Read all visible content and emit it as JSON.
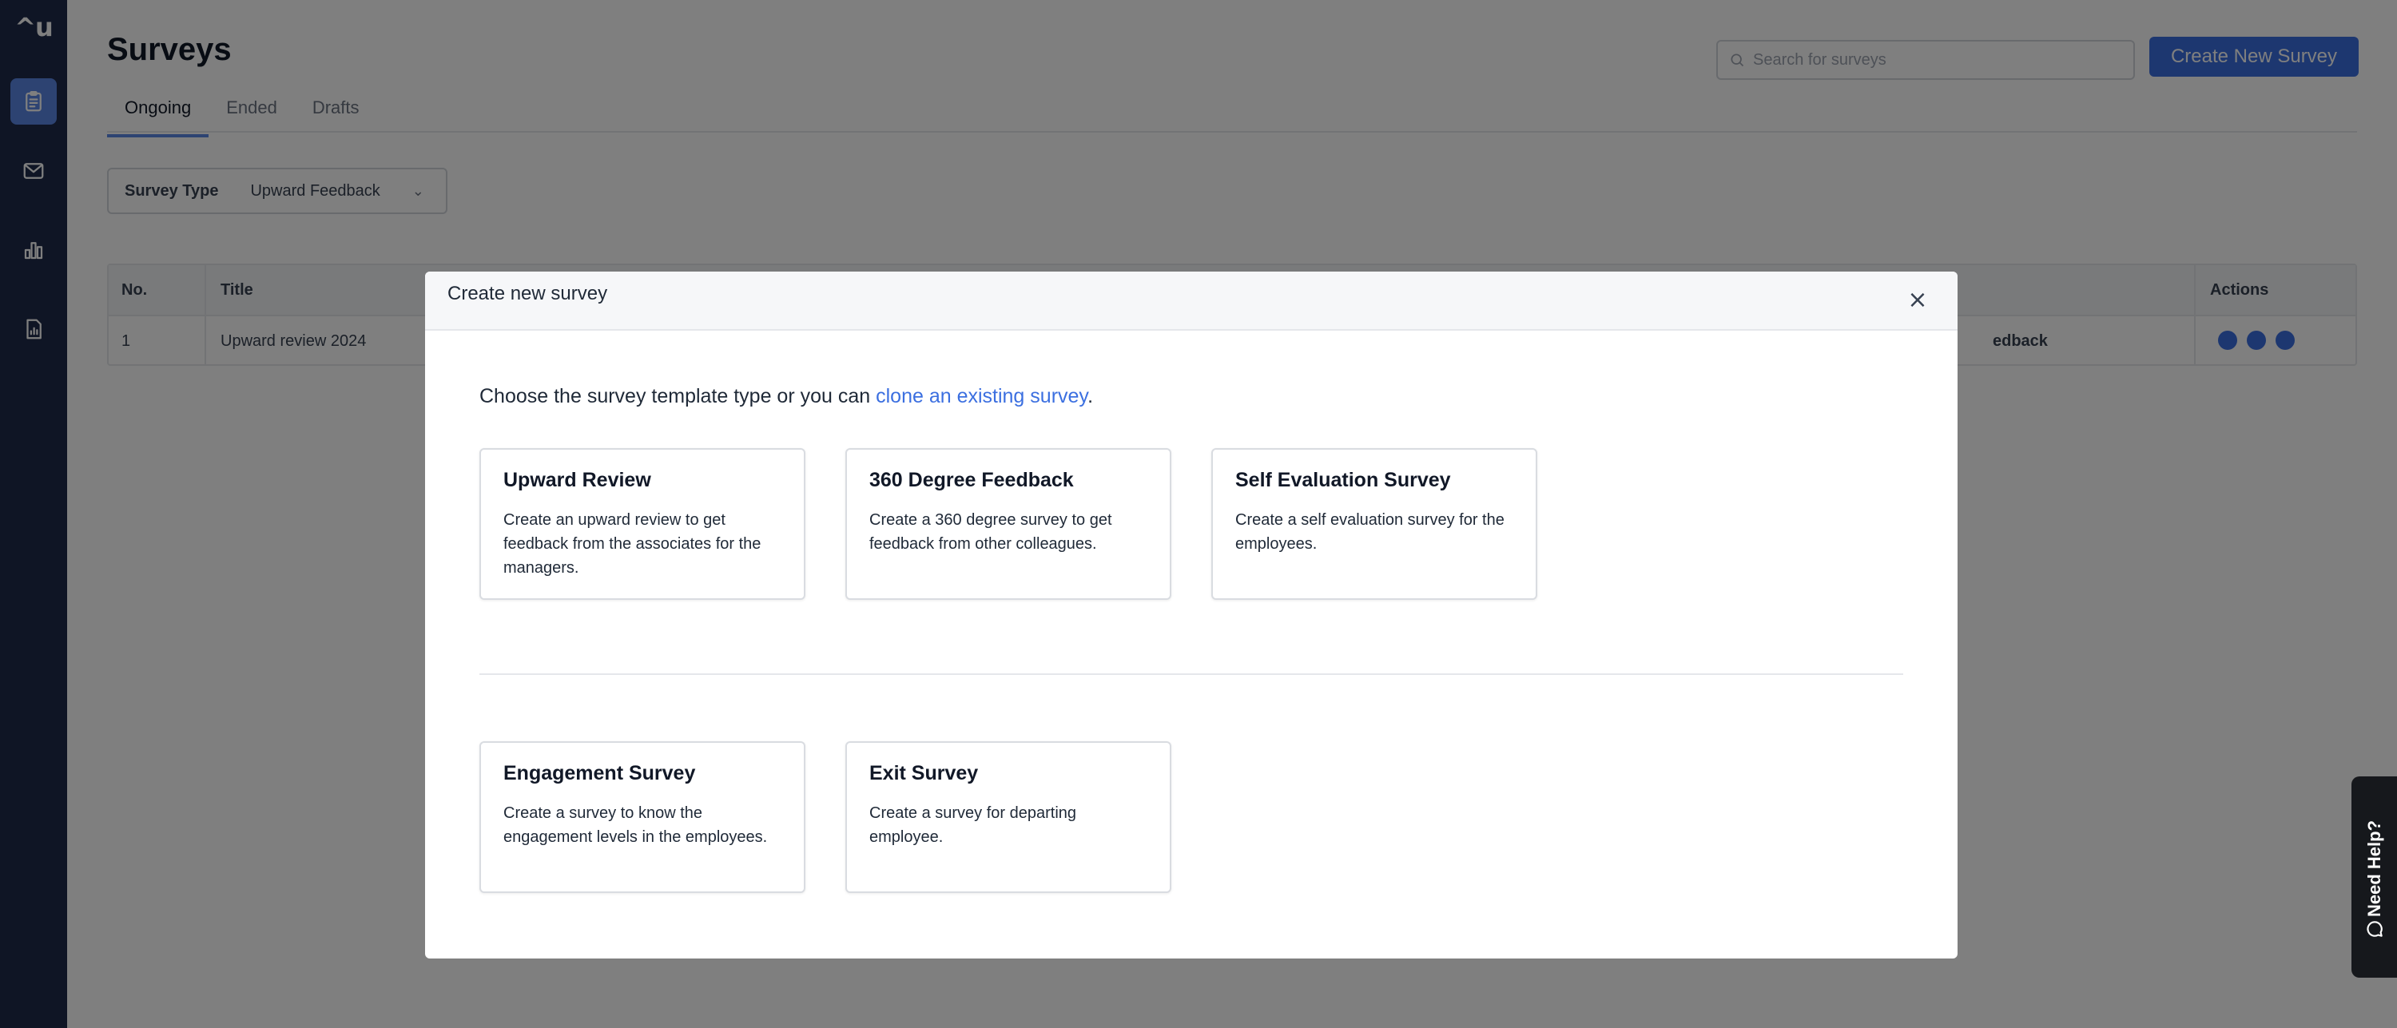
{
  "sidebar": {
    "logo": "^u",
    "items": [
      {
        "name": "surveys",
        "icon": "clipboard-icon",
        "active": true
      },
      {
        "name": "messages",
        "icon": "mail-icon",
        "active": false
      },
      {
        "name": "analytics",
        "icon": "bar-chart-icon",
        "active": false
      },
      {
        "name": "reports",
        "icon": "report-icon",
        "active": false
      }
    ]
  },
  "page": {
    "title": "Surveys",
    "tabs": [
      "Ongoing",
      "Ended",
      "Drafts"
    ],
    "active_tab": "Ongoing",
    "search_placeholder": "Search for surveys",
    "create_button": "Create New Survey",
    "filter": {
      "label": "Survey Type",
      "value": "Upward Feedback"
    },
    "table": {
      "columns": [
        "No.",
        "Title",
        "Actions"
      ],
      "rows": [
        {
          "no": "1",
          "title": "Upward review 2024",
          "type_fragment": "edback"
        }
      ]
    }
  },
  "modal": {
    "title": "Create new survey",
    "close_label": "×",
    "intro_text": "Choose the survey template type or you can ",
    "intro_link": "clone an existing survey",
    "intro_end": ".",
    "templates": [
      {
        "title": "Upward Review",
        "description": "Create an upward review to get feedback from the associates for the managers."
      },
      {
        "title": "360 Degree Feedback",
        "description": "Create a 360 degree survey to get feedback from other colleagues."
      },
      {
        "title": "Self Evaluation Survey",
        "description": "Create a self evaluation survey for the employees."
      },
      {
        "title": "Engagement Survey",
        "description": "Create a survey to know the engagement levels in the employees."
      },
      {
        "title": "Exit Survey",
        "description": "Create a survey for departing employee."
      }
    ]
  },
  "help_widget": {
    "label": "Need Help?",
    "icon": "chat-bubble-icon"
  },
  "colors": {
    "sidebar": "#1e2a4a",
    "accent": "#5b86e5",
    "link": "#3b6fe0",
    "help_widget": "#16181c"
  }
}
